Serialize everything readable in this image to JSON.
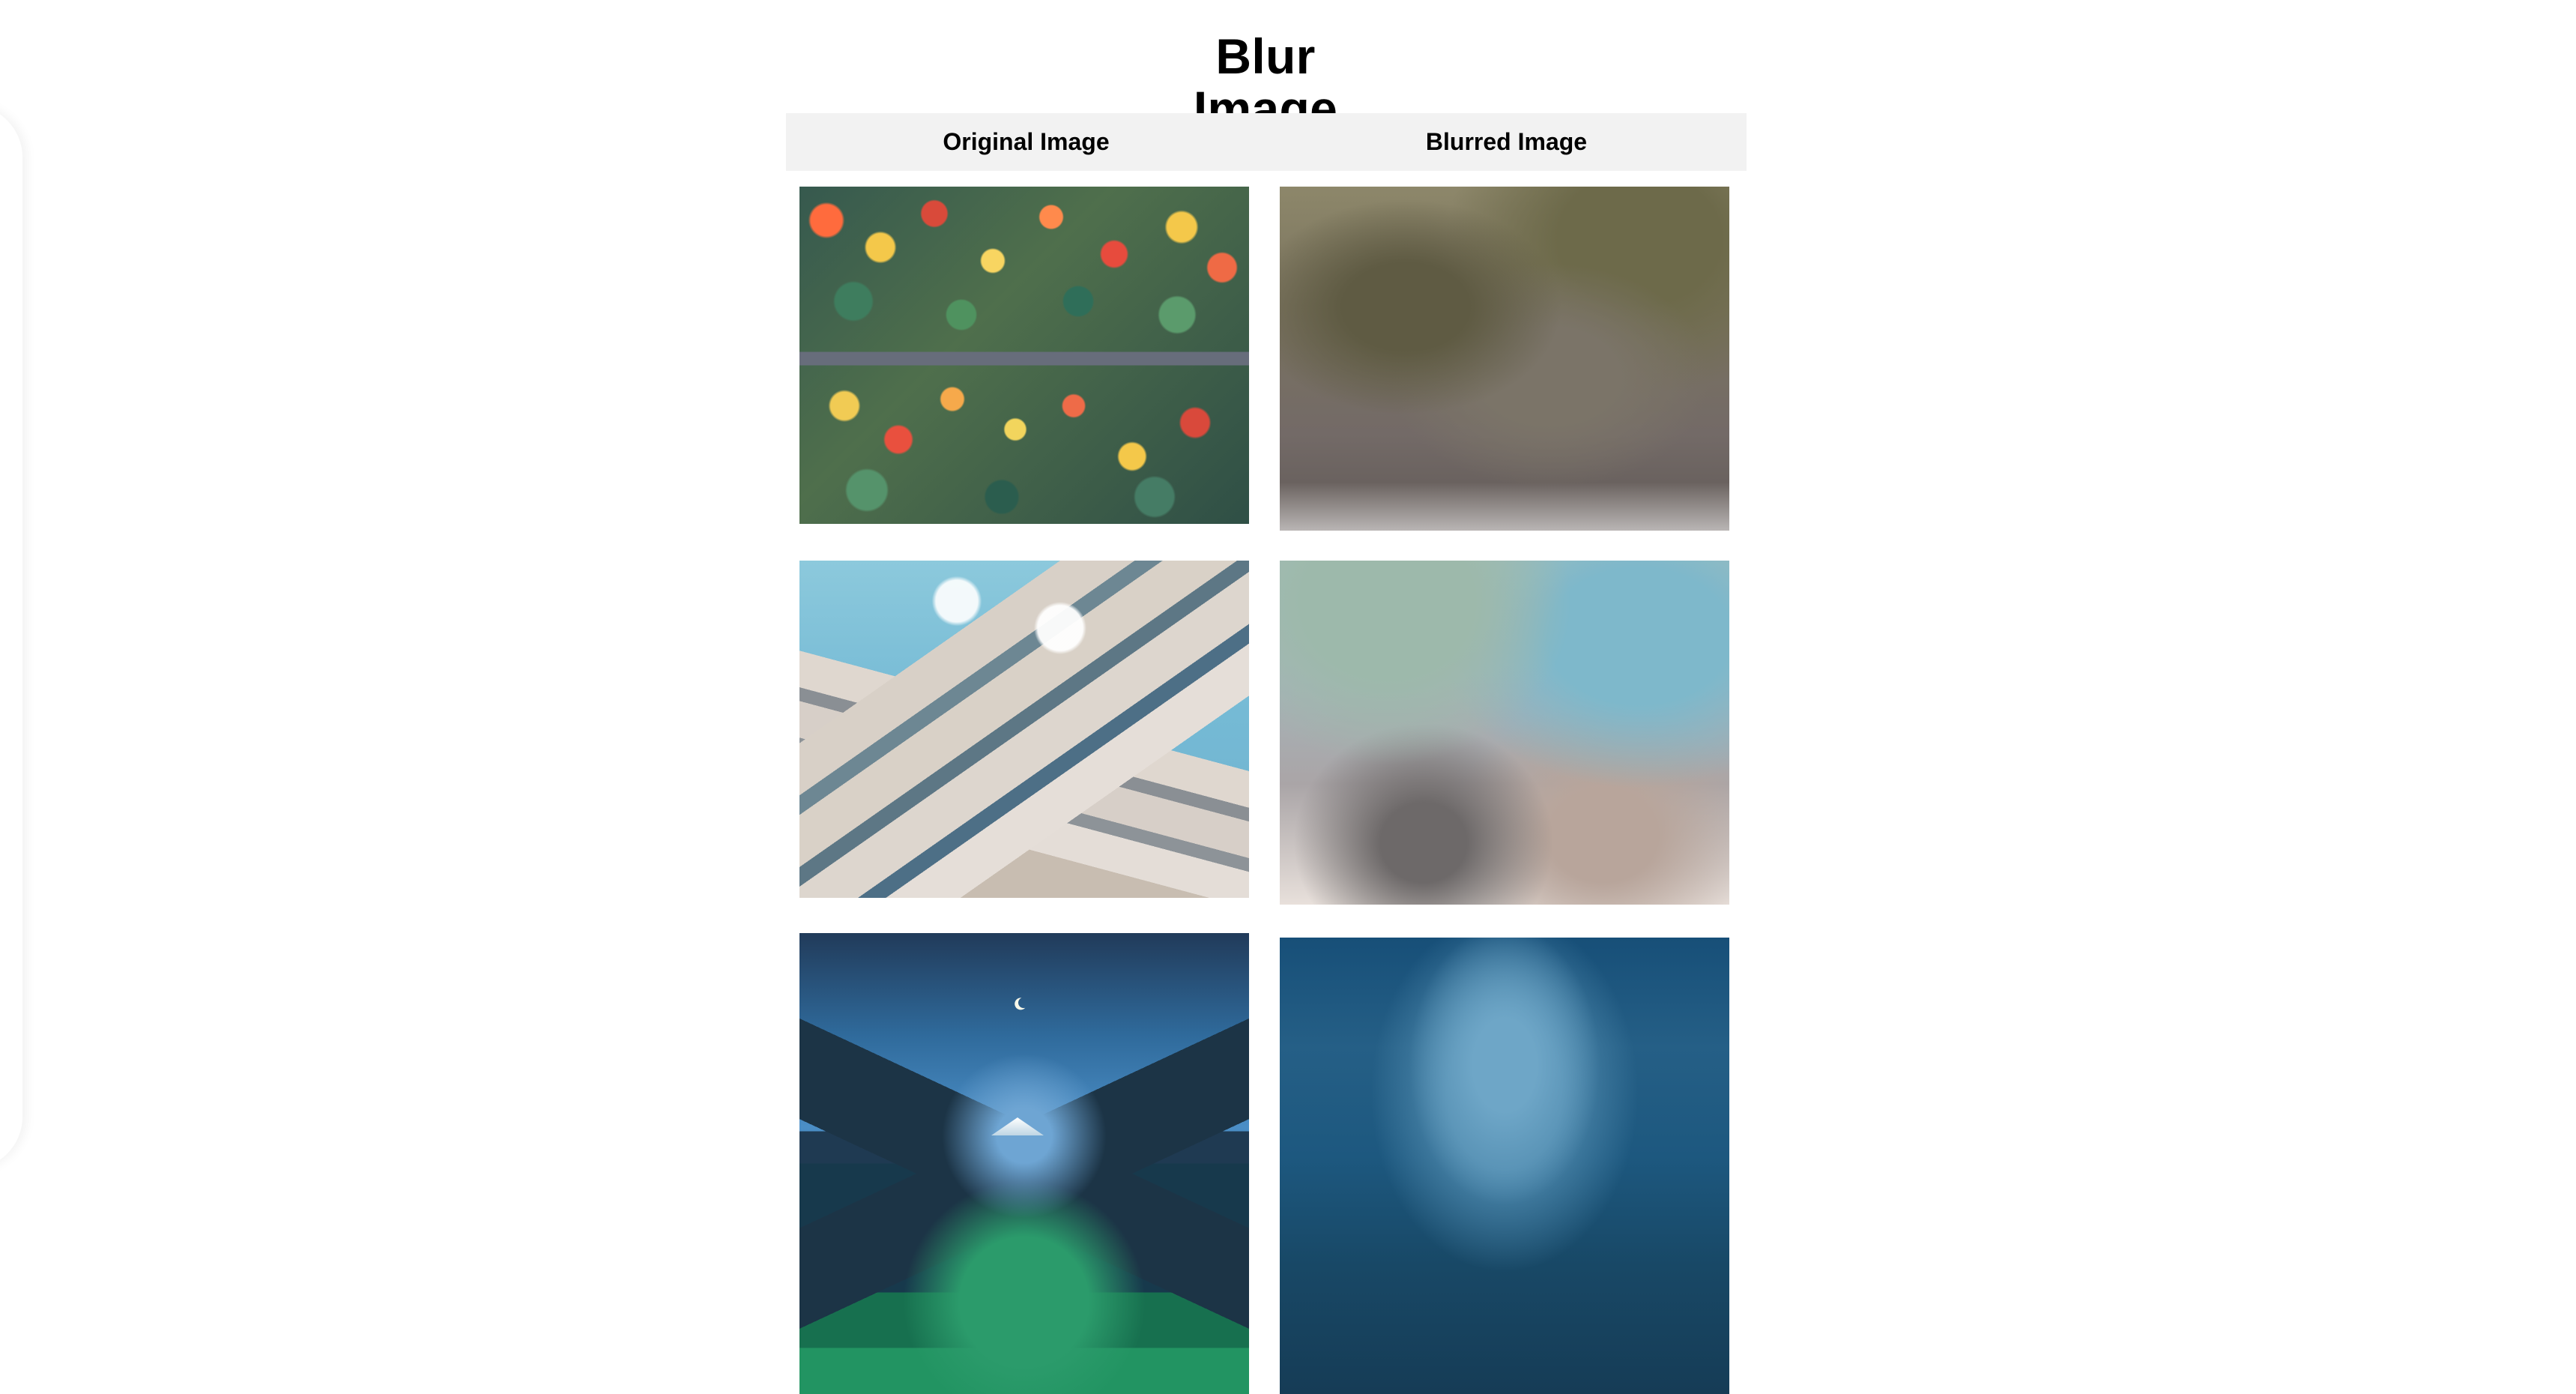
{
  "page": {
    "title": "Blur Image"
  },
  "table": {
    "headers": [
      "Original Image",
      "Blurred Image"
    ],
    "rows": [
      {
        "original": "autumn-forest-road",
        "blurred": "blurred-autumn-forest"
      },
      {
        "original": "building-under-sky",
        "blurred": "blurred-building-sky"
      },
      {
        "original": "night-mountain-landscape",
        "blurred": "blurred-night-mountain"
      }
    ]
  },
  "colors": {
    "background": "#ffffff",
    "header_background": "#f2f2f2",
    "text": "#000000"
  }
}
